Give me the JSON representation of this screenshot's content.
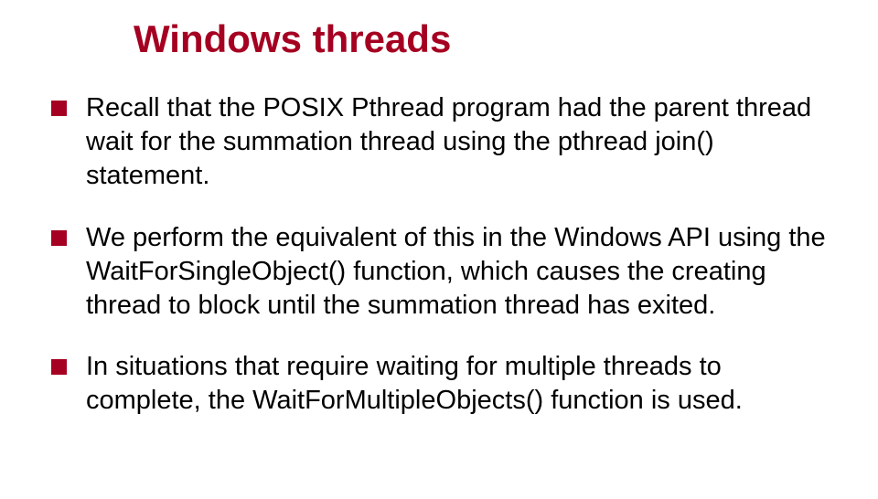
{
  "title": "Windows threads",
  "bullets": [
    "Recall that the POSIX Pthread program had the parent thread wait for the summation thread using the pthread join() statement.",
    "We perform the equivalent of this in the Windows API using the WaitForSingleObject() function, which causes the creating thread to block until the summation thread has exited.",
    "In situations that require waiting for multiple threads to complete, the WaitForMultipleObjects() function is used."
  ],
  "colors": {
    "accent": "#a50021",
    "text": "#000000",
    "background": "#ffffff"
  }
}
